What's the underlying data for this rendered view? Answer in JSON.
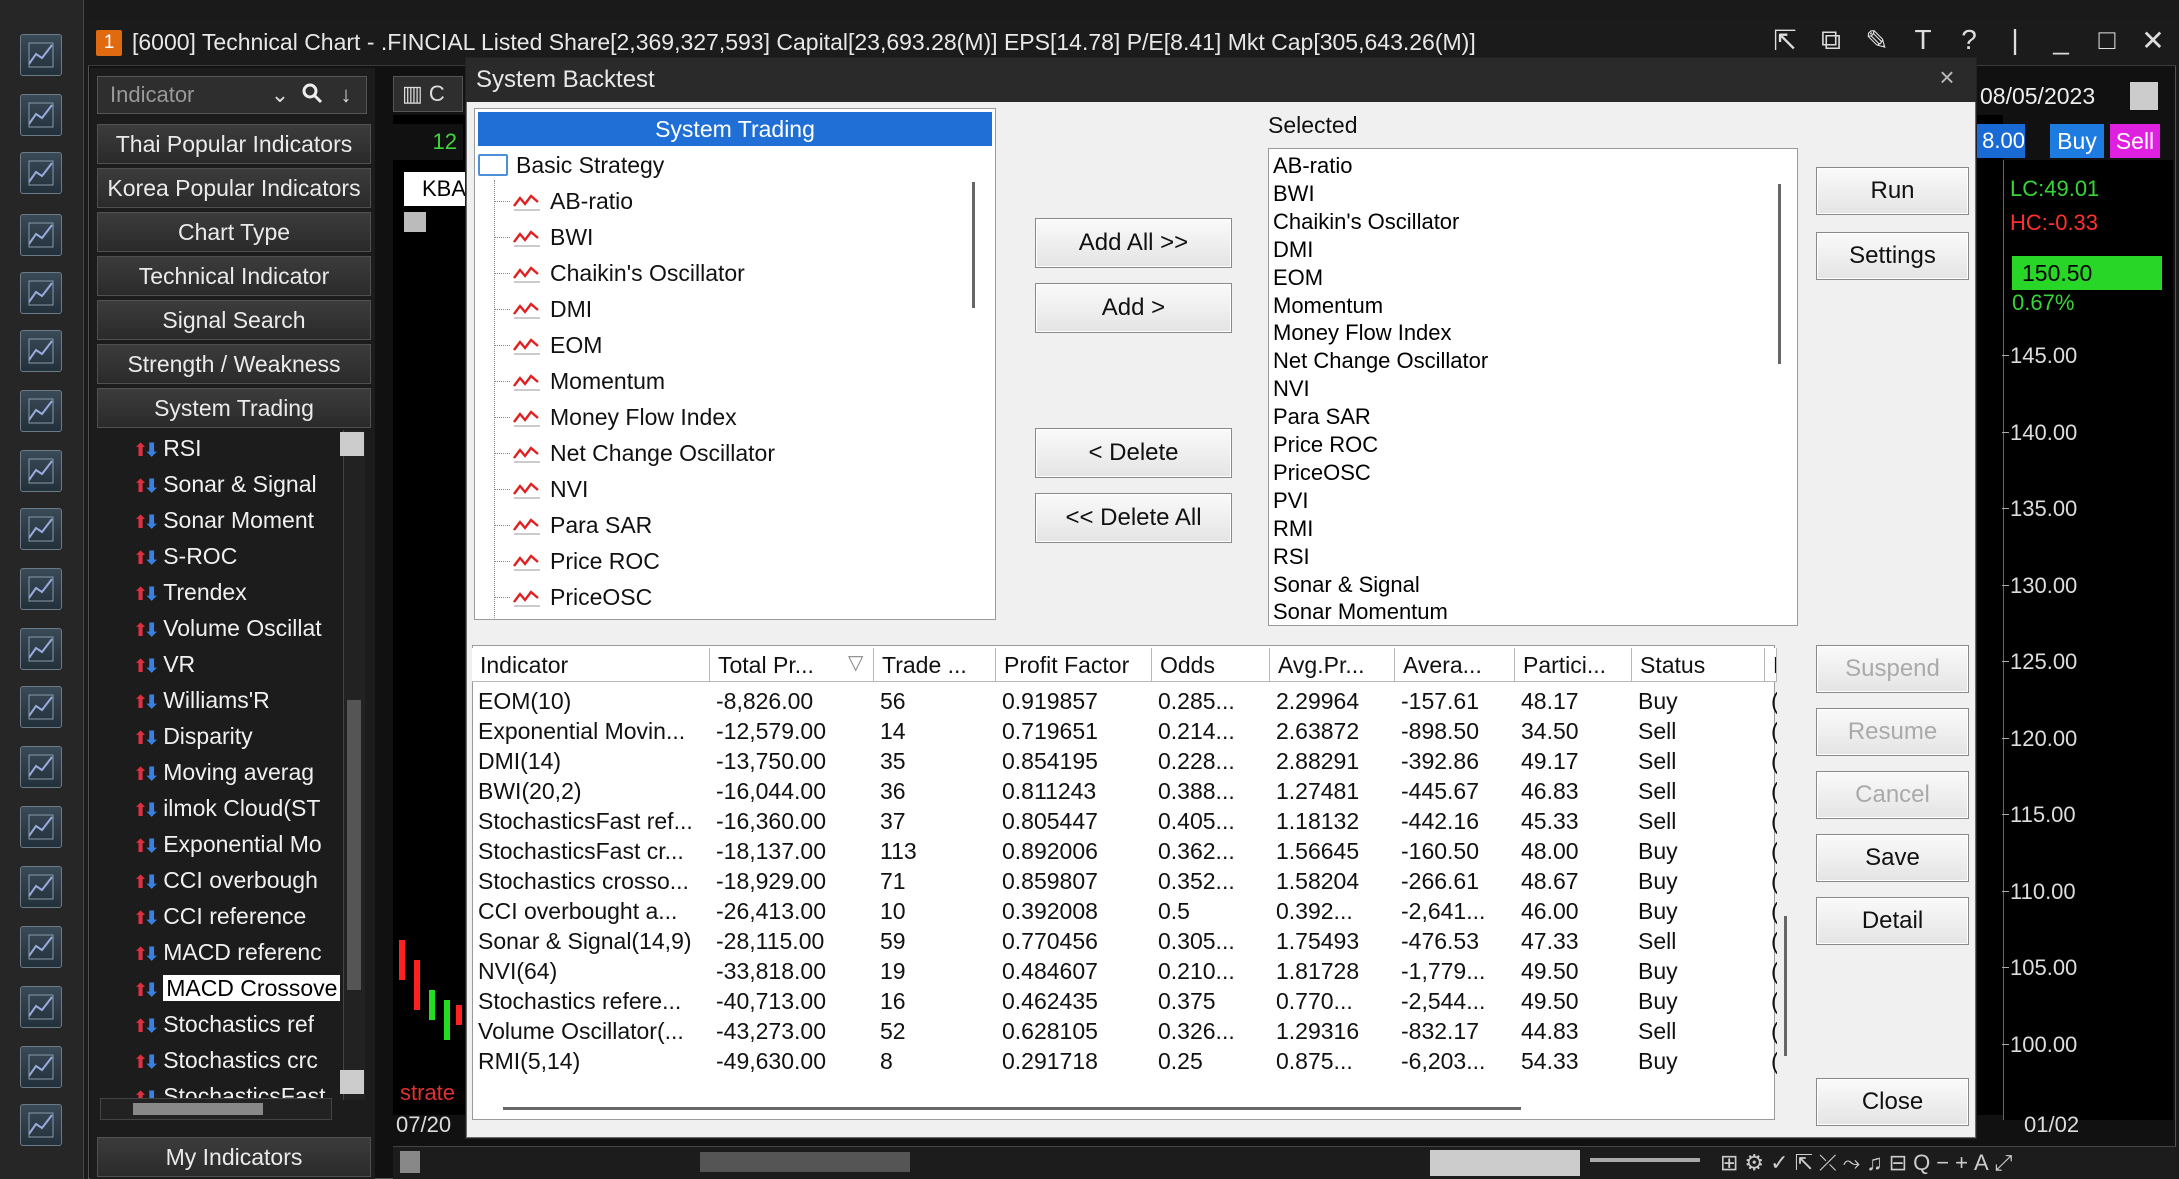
{
  "window": {
    "badge": "1",
    "title": "[6000] Technical Chart - .FINCIAL Listed Share[2,369,327,593] Capital[23,693.28(M)] EPS[14.78] P/E[8.41] Mkt Cap[305,643.26(M)]",
    "controls": [
      "⇱",
      "⧉",
      "✎",
      "T",
      "?",
      "|",
      "_",
      "□",
      "✕"
    ]
  },
  "side_panel": {
    "search_placeholder": "Indicator",
    "categories": [
      "Thai Popular Indicators",
      "Korea Popular Indicators",
      "Chart Type",
      "Technical Indicator",
      "Signal Search",
      "Strength / Weakness",
      "System Trading"
    ],
    "system_trading_items": [
      "RSI",
      "Sonar & Signal",
      "Sonar Moment",
      "S-ROC",
      "Trendex",
      "Volume Oscillat",
      "VR",
      "Williams'R",
      "Disparity",
      "Moving averag",
      "ilmok Cloud(ST",
      "Exponential Mo",
      "CCI overbough",
      "CCI reference",
      "MACD referenc",
      "MACD Crossove",
      "Stochastics ref",
      "Stochastics crc",
      "StochasticsFast"
    ],
    "selected_item_index": 15,
    "my_indicators": "My Indicators"
  },
  "chart_bg": {
    "date_top": "08/05/2023",
    "buy": "Buy",
    "sell": "Sell",
    "price_tag_left": "8.00",
    "lc": "LC:49.01",
    "hc": "HC:-0.33",
    "last_price": "150.50",
    "change": "0.67%",
    "price_levels": [
      "145.00",
      "140.00",
      "135.00",
      "130.00",
      "125.00",
      "120.00",
      "115.00",
      "110.00",
      "105.00",
      "100.00"
    ],
    "x_label_left": "07/20",
    "x_label_right": "01/02",
    "strategy_label": "strate",
    "kba": "KBA",
    "left_num": "12"
  },
  "dialog": {
    "title": "System Backtest",
    "tree_header": "System Trading",
    "tree_root": "Basic Strategy",
    "tree_items": [
      "AB-ratio",
      "BWI",
      "Chaikin's Oscillator",
      "DMI",
      "EOM",
      "Momentum",
      "Money Flow Index",
      "Net Change Oscillator",
      "NVI",
      "Para SAR",
      "Price ROC",
      "PriceOSC"
    ],
    "selected_label": "Selected",
    "selected_items": [
      "AB-ratio",
      "BWI",
      "Chaikin's Oscillator",
      "DMI",
      "EOM",
      "Momentum",
      "Money Flow Index",
      "Net Change Oscillator",
      "NVI",
      "Para SAR",
      "Price ROC",
      "PriceOSC",
      "PVI",
      "RMI",
      "RSI",
      "Sonar & Signal",
      "Sonar Momentum"
    ],
    "buttons": {
      "add_all": "Add All >>",
      "add": "Add >",
      "delete": "< Delete",
      "delete_all": "<< Delete All",
      "run": "Run",
      "settings": "Settings",
      "suspend": "Suspend",
      "resume": "Resume",
      "cancel": "Cancel",
      "save": "Save",
      "detail": "Detail",
      "close": "Close"
    },
    "table": {
      "columns": [
        "Indicator",
        "Total Pr...",
        "Trade ...",
        "Profit Factor",
        "Odds",
        "Avg.Pr...",
        "Avera...",
        "Partici...",
        "Status",
        "F"
      ],
      "sort_indicator": "▽",
      "rows": [
        [
          "EOM(10)",
          "-8,826.00",
          "56",
          "0.919857",
          "0.285...",
          "2.29964",
          "-157.61",
          "48.17",
          "Buy",
          "("
        ],
        [
          "Exponential Movin...",
          "-12,579.00",
          "14",
          "0.719651",
          "0.214...",
          "2.63872",
          "-898.50",
          "34.50",
          "Sell",
          "("
        ],
        [
          "DMI(14)",
          "-13,750.00",
          "35",
          "0.854195",
          "0.228...",
          "2.88291",
          "-392.86",
          "49.17",
          "Sell",
          "("
        ],
        [
          "BWI(20,2)",
          "-16,044.00",
          "36",
          "0.811243",
          "0.388...",
          "1.27481",
          "-445.67",
          "46.83",
          "Sell",
          "("
        ],
        [
          "StochasticsFast ref...",
          "-16,360.00",
          "37",
          "0.805447",
          "0.405...",
          "1.18132",
          "-442.16",
          "45.33",
          "Sell",
          "("
        ],
        [
          "StochasticsFast cr...",
          "-18,137.00",
          "113",
          "0.892006",
          "0.362...",
          "1.56645",
          "-160.50",
          "48.00",
          "Buy",
          "("
        ],
        [
          "Stochastics crosso...",
          "-18,929.00",
          "71",
          "0.859807",
          "0.352...",
          "1.58204",
          "-266.61",
          "48.67",
          "Buy",
          "("
        ],
        [
          "CCI overbought a...",
          "-26,413.00",
          "10",
          "0.392008",
          "0.5",
          "0.392...",
          "-2,641...",
          "46.00",
          "Buy",
          "("
        ],
        [
          "Sonar & Signal(14,9)",
          "-28,115.00",
          "59",
          "0.770456",
          "0.305...",
          "1.75493",
          "-476.53",
          "47.33",
          "Sell",
          "("
        ],
        [
          "NVI(64)",
          "-33,818.00",
          "19",
          "0.484607",
          "0.210...",
          "1.81728",
          "-1,779...",
          "49.50",
          "Buy",
          "("
        ],
        [
          "Stochastics refere...",
          "-40,713.00",
          "16",
          "0.462435",
          "0.375",
          "0.770...",
          "-2,544...",
          "49.50",
          "Buy",
          "("
        ],
        [
          "Volume Oscillator(...",
          "-43,273.00",
          "52",
          "0.628105",
          "0.326...",
          "1.29316",
          "-832.17",
          "44.83",
          "Sell",
          "("
        ],
        [
          "RMI(5,14)",
          "-49,630.00",
          "8",
          "0.291718",
          "0.25",
          "0.875...",
          "-6,203...",
          "54.33",
          "Buy",
          "("
        ]
      ]
    }
  },
  "colors": {
    "tree_header": "#1f6fd6",
    "buy_button": "#1e7be0",
    "sell_button": "#e020e0",
    "lc_green": "#36d636",
    "hc_red": "#ff3030",
    "last_price_bg": "#28d628"
  }
}
